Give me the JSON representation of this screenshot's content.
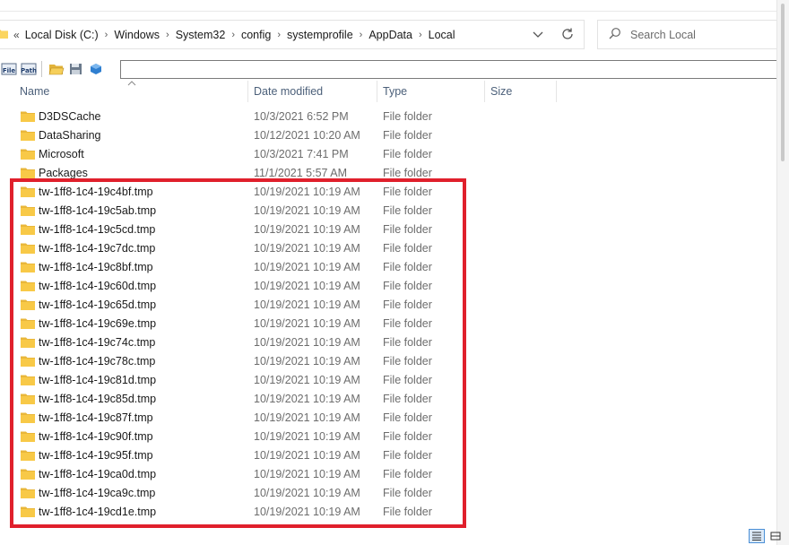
{
  "address": {
    "overflow": "«",
    "crumbs": [
      "Local Disk (C:)",
      "Windows",
      "System32",
      "config",
      "systemprofile",
      "AppData",
      "Local"
    ]
  },
  "search": {
    "placeholder": "Search Local"
  },
  "toolbar": {
    "buttons": [
      {
        "name": "file-button",
        "label": "File"
      },
      {
        "name": "path-button",
        "label": "Path"
      }
    ]
  },
  "columns": {
    "name": "Name",
    "date": "Date modified",
    "type": "Type",
    "size": "Size"
  },
  "rows": [
    {
      "name": "D3DSCache",
      "date": "10/3/2021 6:52 PM",
      "type": "File folder"
    },
    {
      "name": "DataSharing",
      "date": "10/12/2021 10:20 AM",
      "type": "File folder"
    },
    {
      "name": "Microsoft",
      "date": "10/3/2021 7:41 PM",
      "type": "File folder"
    },
    {
      "name": "Packages",
      "date": "11/1/2021 5:57 AM",
      "type": "File folder"
    },
    {
      "name": "tw-1ff8-1c4-19c4bf.tmp",
      "date": "10/19/2021 10:19 AM",
      "type": "File folder"
    },
    {
      "name": "tw-1ff8-1c4-19c5ab.tmp",
      "date": "10/19/2021 10:19 AM",
      "type": "File folder"
    },
    {
      "name": "tw-1ff8-1c4-19c5cd.tmp",
      "date": "10/19/2021 10:19 AM",
      "type": "File folder"
    },
    {
      "name": "tw-1ff8-1c4-19c7dc.tmp",
      "date": "10/19/2021 10:19 AM",
      "type": "File folder"
    },
    {
      "name": "tw-1ff8-1c4-19c8bf.tmp",
      "date": "10/19/2021 10:19 AM",
      "type": "File folder"
    },
    {
      "name": "tw-1ff8-1c4-19c60d.tmp",
      "date": "10/19/2021 10:19 AM",
      "type": "File folder"
    },
    {
      "name": "tw-1ff8-1c4-19c65d.tmp",
      "date": "10/19/2021 10:19 AM",
      "type": "File folder"
    },
    {
      "name": "tw-1ff8-1c4-19c69e.tmp",
      "date": "10/19/2021 10:19 AM",
      "type": "File folder"
    },
    {
      "name": "tw-1ff8-1c4-19c74c.tmp",
      "date": "10/19/2021 10:19 AM",
      "type": "File folder"
    },
    {
      "name": "tw-1ff8-1c4-19c78c.tmp",
      "date": "10/19/2021 10:19 AM",
      "type": "File folder"
    },
    {
      "name": "tw-1ff8-1c4-19c81d.tmp",
      "date": "10/19/2021 10:19 AM",
      "type": "File folder"
    },
    {
      "name": "tw-1ff8-1c4-19c85d.tmp",
      "date": "10/19/2021 10:19 AM",
      "type": "File folder"
    },
    {
      "name": "tw-1ff8-1c4-19c87f.tmp",
      "date": "10/19/2021 10:19 AM",
      "type": "File folder"
    },
    {
      "name": "tw-1ff8-1c4-19c90f.tmp",
      "date": "10/19/2021 10:19 AM",
      "type": "File folder"
    },
    {
      "name": "tw-1ff8-1c4-19c95f.tmp",
      "date": "10/19/2021 10:19 AM",
      "type": "File folder"
    },
    {
      "name": "tw-1ff8-1c4-19ca0d.tmp",
      "date": "10/19/2021 10:19 AM",
      "type": "File folder"
    },
    {
      "name": "tw-1ff8-1c4-19ca9c.tmp",
      "date": "10/19/2021 10:19 AM",
      "type": "File folder"
    },
    {
      "name": "tw-1ff8-1c4-19cd1e.tmp",
      "date": "10/19/2021 10:19 AM",
      "type": "File folder"
    }
  ],
  "colors": {
    "highlight": "#e0202c",
    "folder": "#f8c947",
    "header_text": "#4c607a"
  }
}
